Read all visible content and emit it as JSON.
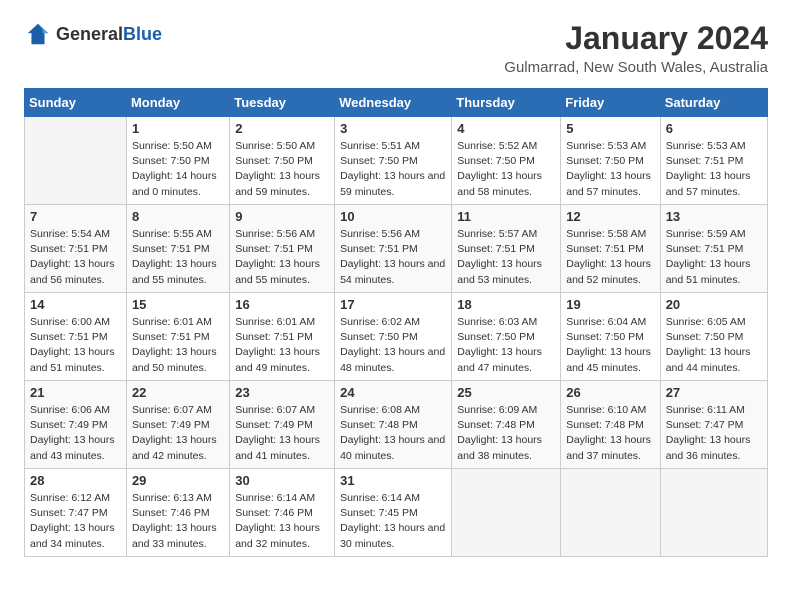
{
  "logo": {
    "text_general": "General",
    "text_blue": "Blue"
  },
  "title": {
    "month_year": "January 2024",
    "location": "Gulmarrad, New South Wales, Australia"
  },
  "days_of_week": [
    "Sunday",
    "Monday",
    "Tuesday",
    "Wednesday",
    "Thursday",
    "Friday",
    "Saturday"
  ],
  "weeks": [
    [
      {
        "day": "",
        "sunrise": "",
        "sunset": "",
        "daylight": "",
        "empty": true
      },
      {
        "day": "1",
        "sunrise": "Sunrise: 5:50 AM",
        "sunset": "Sunset: 7:50 PM",
        "daylight": "Daylight: 14 hours and 0 minutes."
      },
      {
        "day": "2",
        "sunrise": "Sunrise: 5:50 AM",
        "sunset": "Sunset: 7:50 PM",
        "daylight": "Daylight: 13 hours and 59 minutes."
      },
      {
        "day": "3",
        "sunrise": "Sunrise: 5:51 AM",
        "sunset": "Sunset: 7:50 PM",
        "daylight": "Daylight: 13 hours and 59 minutes."
      },
      {
        "day": "4",
        "sunrise": "Sunrise: 5:52 AM",
        "sunset": "Sunset: 7:50 PM",
        "daylight": "Daylight: 13 hours and 58 minutes."
      },
      {
        "day": "5",
        "sunrise": "Sunrise: 5:53 AM",
        "sunset": "Sunset: 7:50 PM",
        "daylight": "Daylight: 13 hours and 57 minutes."
      },
      {
        "day": "6",
        "sunrise": "Sunrise: 5:53 AM",
        "sunset": "Sunset: 7:51 PM",
        "daylight": "Daylight: 13 hours and 57 minutes."
      }
    ],
    [
      {
        "day": "7",
        "sunrise": "Sunrise: 5:54 AM",
        "sunset": "Sunset: 7:51 PM",
        "daylight": "Daylight: 13 hours and 56 minutes."
      },
      {
        "day": "8",
        "sunrise": "Sunrise: 5:55 AM",
        "sunset": "Sunset: 7:51 PM",
        "daylight": "Daylight: 13 hours and 55 minutes."
      },
      {
        "day": "9",
        "sunrise": "Sunrise: 5:56 AM",
        "sunset": "Sunset: 7:51 PM",
        "daylight": "Daylight: 13 hours and 55 minutes."
      },
      {
        "day": "10",
        "sunrise": "Sunrise: 5:56 AM",
        "sunset": "Sunset: 7:51 PM",
        "daylight": "Daylight: 13 hours and 54 minutes."
      },
      {
        "day": "11",
        "sunrise": "Sunrise: 5:57 AM",
        "sunset": "Sunset: 7:51 PM",
        "daylight": "Daylight: 13 hours and 53 minutes."
      },
      {
        "day": "12",
        "sunrise": "Sunrise: 5:58 AM",
        "sunset": "Sunset: 7:51 PM",
        "daylight": "Daylight: 13 hours and 52 minutes."
      },
      {
        "day": "13",
        "sunrise": "Sunrise: 5:59 AM",
        "sunset": "Sunset: 7:51 PM",
        "daylight": "Daylight: 13 hours and 51 minutes."
      }
    ],
    [
      {
        "day": "14",
        "sunrise": "Sunrise: 6:00 AM",
        "sunset": "Sunset: 7:51 PM",
        "daylight": "Daylight: 13 hours and 51 minutes."
      },
      {
        "day": "15",
        "sunrise": "Sunrise: 6:01 AM",
        "sunset": "Sunset: 7:51 PM",
        "daylight": "Daylight: 13 hours and 50 minutes."
      },
      {
        "day": "16",
        "sunrise": "Sunrise: 6:01 AM",
        "sunset": "Sunset: 7:51 PM",
        "daylight": "Daylight: 13 hours and 49 minutes."
      },
      {
        "day": "17",
        "sunrise": "Sunrise: 6:02 AM",
        "sunset": "Sunset: 7:50 PM",
        "daylight": "Daylight: 13 hours and 48 minutes."
      },
      {
        "day": "18",
        "sunrise": "Sunrise: 6:03 AM",
        "sunset": "Sunset: 7:50 PM",
        "daylight": "Daylight: 13 hours and 47 minutes."
      },
      {
        "day": "19",
        "sunrise": "Sunrise: 6:04 AM",
        "sunset": "Sunset: 7:50 PM",
        "daylight": "Daylight: 13 hours and 45 minutes."
      },
      {
        "day": "20",
        "sunrise": "Sunrise: 6:05 AM",
        "sunset": "Sunset: 7:50 PM",
        "daylight": "Daylight: 13 hours and 44 minutes."
      }
    ],
    [
      {
        "day": "21",
        "sunrise": "Sunrise: 6:06 AM",
        "sunset": "Sunset: 7:49 PM",
        "daylight": "Daylight: 13 hours and 43 minutes."
      },
      {
        "day": "22",
        "sunrise": "Sunrise: 6:07 AM",
        "sunset": "Sunset: 7:49 PM",
        "daylight": "Daylight: 13 hours and 42 minutes."
      },
      {
        "day": "23",
        "sunrise": "Sunrise: 6:07 AM",
        "sunset": "Sunset: 7:49 PM",
        "daylight": "Daylight: 13 hours and 41 minutes."
      },
      {
        "day": "24",
        "sunrise": "Sunrise: 6:08 AM",
        "sunset": "Sunset: 7:48 PM",
        "daylight": "Daylight: 13 hours and 40 minutes."
      },
      {
        "day": "25",
        "sunrise": "Sunrise: 6:09 AM",
        "sunset": "Sunset: 7:48 PM",
        "daylight": "Daylight: 13 hours and 38 minutes."
      },
      {
        "day": "26",
        "sunrise": "Sunrise: 6:10 AM",
        "sunset": "Sunset: 7:48 PM",
        "daylight": "Daylight: 13 hours and 37 minutes."
      },
      {
        "day": "27",
        "sunrise": "Sunrise: 6:11 AM",
        "sunset": "Sunset: 7:47 PM",
        "daylight": "Daylight: 13 hours and 36 minutes."
      }
    ],
    [
      {
        "day": "28",
        "sunrise": "Sunrise: 6:12 AM",
        "sunset": "Sunset: 7:47 PM",
        "daylight": "Daylight: 13 hours and 34 minutes."
      },
      {
        "day": "29",
        "sunrise": "Sunrise: 6:13 AM",
        "sunset": "Sunset: 7:46 PM",
        "daylight": "Daylight: 13 hours and 33 minutes."
      },
      {
        "day": "30",
        "sunrise": "Sunrise: 6:14 AM",
        "sunset": "Sunset: 7:46 PM",
        "daylight": "Daylight: 13 hours and 32 minutes."
      },
      {
        "day": "31",
        "sunrise": "Sunrise: 6:14 AM",
        "sunset": "Sunset: 7:45 PM",
        "daylight": "Daylight: 13 hours and 30 minutes."
      },
      {
        "day": "",
        "sunrise": "",
        "sunset": "",
        "daylight": "",
        "empty": true
      },
      {
        "day": "",
        "sunrise": "",
        "sunset": "",
        "daylight": "",
        "empty": true
      },
      {
        "day": "",
        "sunrise": "",
        "sunset": "",
        "daylight": "",
        "empty": true
      }
    ]
  ]
}
